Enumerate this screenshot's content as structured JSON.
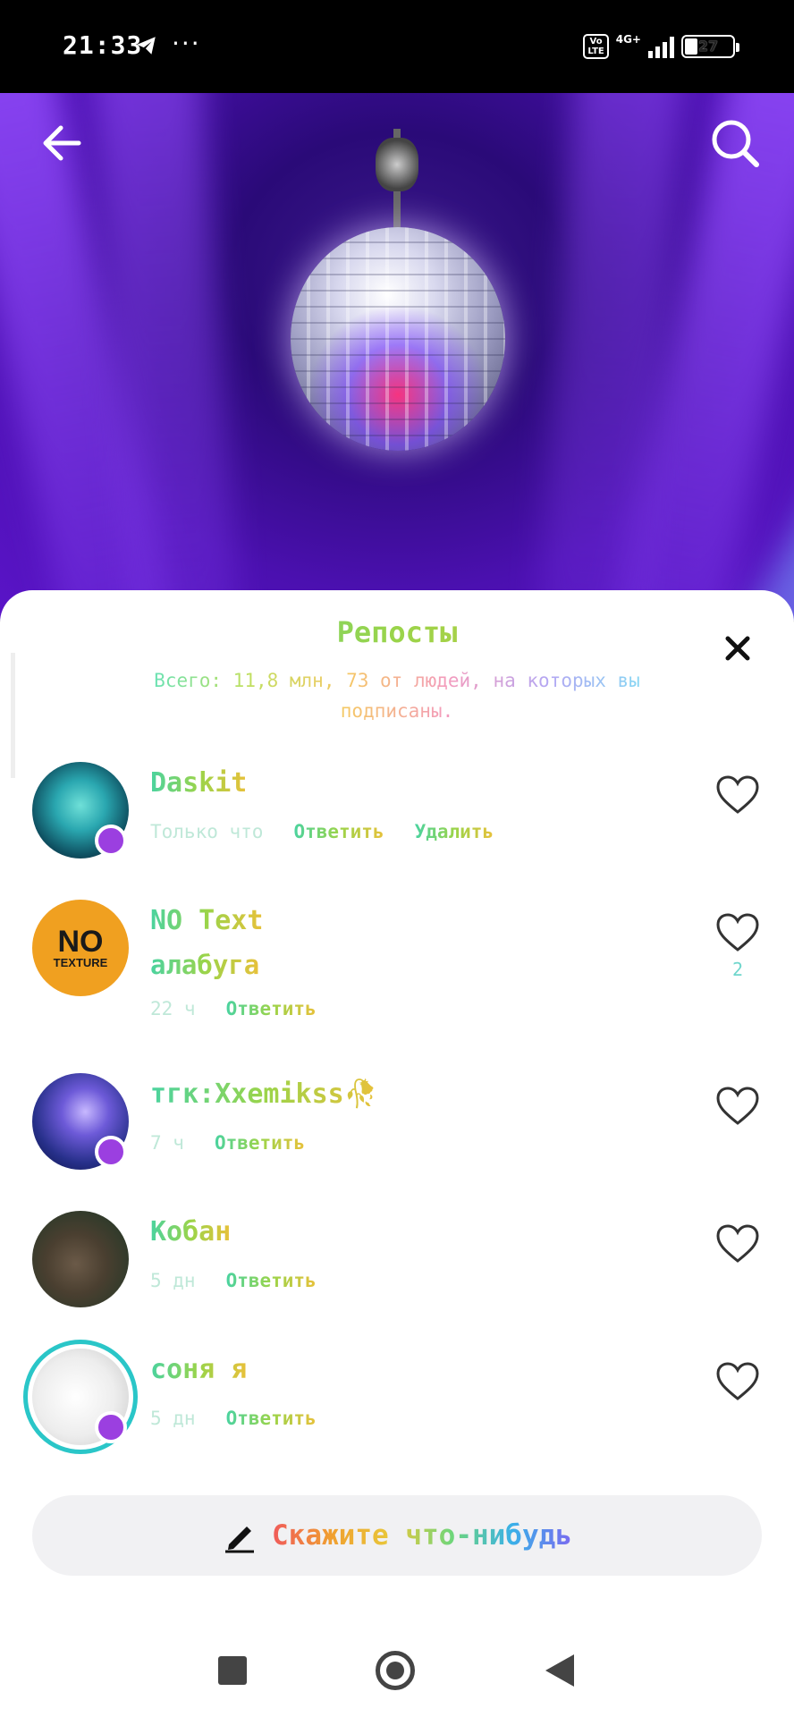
{
  "status_bar": {
    "time": "21:33",
    "extra": "···",
    "volte": "Vo\nLTE",
    "network": "4G+",
    "battery": "27"
  },
  "header": {
    "back_icon": "arrow-left-icon",
    "search_icon": "search-icon"
  },
  "sheet": {
    "title": "Репосты",
    "subtitle": "Всего: 11,8 млн, 73 от людей, на которых вы подписаны.",
    "close_icon": "close-icon"
  },
  "comments": [
    {
      "name": "Daskit",
      "text": "",
      "time": "Только что",
      "actions": [
        "Ответить",
        "Удалить"
      ],
      "likes": ""
    },
    {
      "name": "NO Text",
      "text": "алабуга",
      "time": "22 ч",
      "actions": [
        "Ответить"
      ],
      "likes": "2",
      "avatar_text": {
        "big": "NO",
        "small": "TEXTURE"
      }
    },
    {
      "name": "тгк:Xxemikss🥀",
      "text": "",
      "time": "7 ч",
      "actions": [
        "Ответить"
      ],
      "likes": ""
    },
    {
      "name": "Кобан",
      "text": "",
      "time": "5 дн",
      "actions": [
        "Ответить"
      ],
      "likes": ""
    },
    {
      "name": "соня я",
      "text": "",
      "time": "5 дн",
      "actions": [
        "Ответить"
      ],
      "likes": ""
    }
  ],
  "composer": {
    "placeholder": "Скажите что-нибудь",
    "icon": "pencil-icon"
  },
  "colors": {
    "badge": "#9b3fe0",
    "story_ring": "#2ac6c8",
    "sheet_bg": "#ffffff"
  }
}
